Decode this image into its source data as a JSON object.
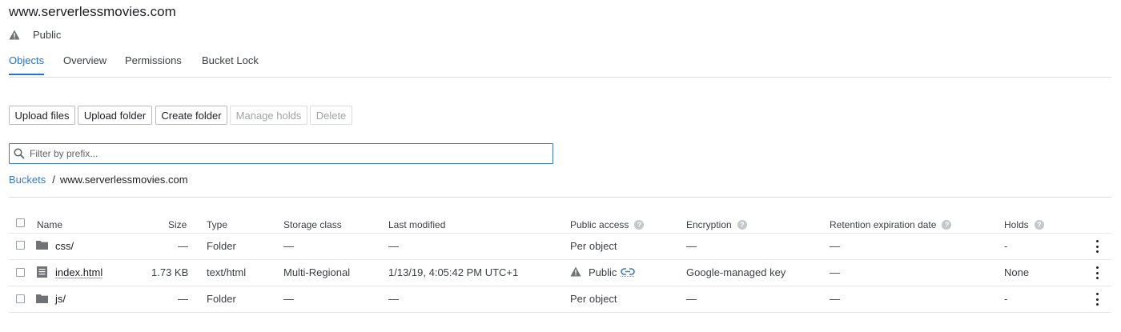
{
  "bucket": {
    "title": "www.serverlessmovies.com",
    "visibility": "Public"
  },
  "tabs": [
    {
      "label": "Objects",
      "active": true
    },
    {
      "label": "Overview",
      "active": false
    },
    {
      "label": "Permissions",
      "active": false
    },
    {
      "label": "Bucket Lock",
      "active": false
    }
  ],
  "toolbar": {
    "upload_files": "Upload files",
    "upload_folder": "Upload folder",
    "create_folder": "Create folder",
    "manage_holds": "Manage holds",
    "delete": "Delete"
  },
  "filter": {
    "placeholder": "Filter by prefix...",
    "value": ""
  },
  "breadcrumb": {
    "root": "Buckets",
    "separator": "/",
    "current": "www.serverlessmovies.com"
  },
  "table": {
    "headers": {
      "name": "Name",
      "size": "Size",
      "type": "Type",
      "storage_class": "Storage class",
      "last_modified": "Last modified",
      "public_access": "Public access",
      "encryption": "Encryption",
      "retention": "Retention expiration date",
      "holds": "Holds"
    },
    "rows": [
      {
        "name": "css/",
        "icon": "folder-icon",
        "size": "—",
        "type": "Folder",
        "storage_class": "—",
        "last_modified": "—",
        "public_access": "Per object",
        "encryption": "—",
        "retention": "—",
        "holds": "-"
      },
      {
        "name": "index.html",
        "icon": "file-icon",
        "size": "1.73 KB",
        "type": "text/html",
        "storage_class": "Multi-Regional",
        "last_modified": "1/13/19, 4:05:42 PM UTC+1",
        "public_access": "Public",
        "encryption": "Google-managed key",
        "retention": "—",
        "holds": "None"
      },
      {
        "name": "js/",
        "icon": "folder-icon",
        "size": "—",
        "type": "Folder",
        "storage_class": "—",
        "last_modified": "—",
        "public_access": "Per object",
        "encryption": "—",
        "retention": "—",
        "holds": "-"
      }
    ]
  },
  "colors": {
    "accent": "#1a73e8",
    "link": "#3c78c6",
    "text": "#202124",
    "divider": "#dadce0"
  }
}
